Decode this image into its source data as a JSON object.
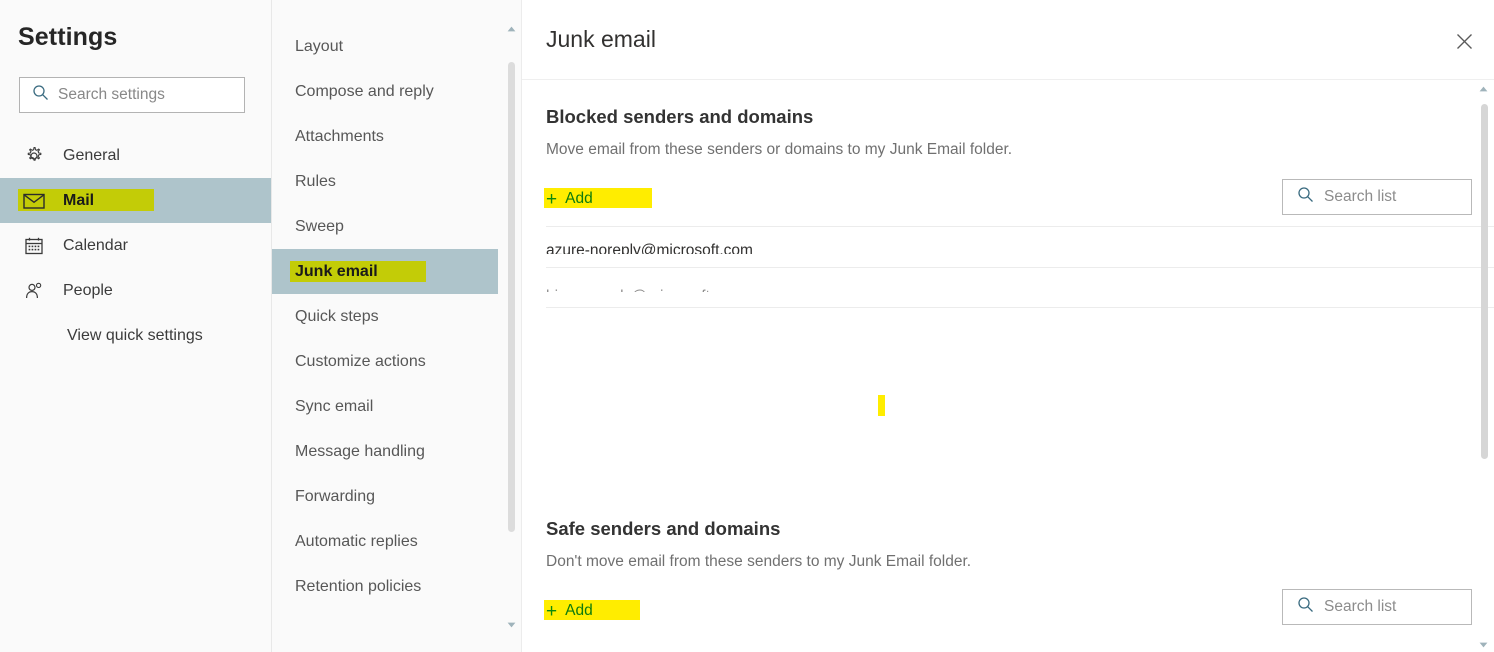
{
  "sidebar": {
    "title": "Settings",
    "search": {
      "placeholder": "Search settings",
      "icon": "search-icon"
    },
    "items": [
      {
        "label": "General",
        "icon": "gear-icon",
        "selected": false
      },
      {
        "label": "Mail",
        "icon": "envelope-icon",
        "selected": true
      },
      {
        "label": "Calendar",
        "icon": "calendar-icon",
        "selected": false
      },
      {
        "label": "People",
        "icon": "people-icon",
        "selected": false
      }
    ],
    "quick_settings_label": "View quick settings",
    "selected_highlight_color": "#aec4cb",
    "marker_color": "#c3cc07"
  },
  "midnav": {
    "items": [
      {
        "label": "Layout",
        "selected": false
      },
      {
        "label": "Compose and reply",
        "selected": false
      },
      {
        "label": "Attachments",
        "selected": false
      },
      {
        "label": "Rules",
        "selected": false
      },
      {
        "label": "Sweep",
        "selected": false
      },
      {
        "label": "Junk email",
        "selected": true
      },
      {
        "label": "Quick steps",
        "selected": false
      },
      {
        "label": "Customize actions",
        "selected": false
      },
      {
        "label": "Sync email",
        "selected": false
      },
      {
        "label": "Message handling",
        "selected": false
      },
      {
        "label": "Forwarding",
        "selected": false
      },
      {
        "label": "Automatic replies",
        "selected": false
      },
      {
        "label": "Retention policies",
        "selected": false
      }
    ]
  },
  "main": {
    "title": "Junk email",
    "close_icon": "close-icon",
    "blocked": {
      "heading": "Blocked senders and domains",
      "description": "Move email from these senders or domains to my Junk Email folder.",
      "add_label": "Add",
      "add_plus": "+",
      "search": {
        "placeholder": "Search list",
        "icon": "search-icon"
      },
      "entries": [
        {
          "address": "azure-noreply@microsoft.com"
        },
        {
          "address": "bing-noreply@microsoft.com"
        }
      ],
      "edit_icon": "pencil-icon",
      "delete_icon": "trash-icon"
    },
    "safe": {
      "heading": "Safe senders and domains",
      "description": "Don't move email from these senders to my Junk Email folder.",
      "add_label": "Add",
      "add_plus": "+",
      "search": {
        "placeholder": "Search list",
        "icon": "search-icon"
      }
    }
  },
  "colors": {
    "marker_yellow": "#ffed00",
    "marker_over_selection": "#c3cc07",
    "selection_blue_gray": "#aec4cb",
    "add_link_green": "#0d7b0d",
    "icon_steel_blue": "#4a7184"
  }
}
